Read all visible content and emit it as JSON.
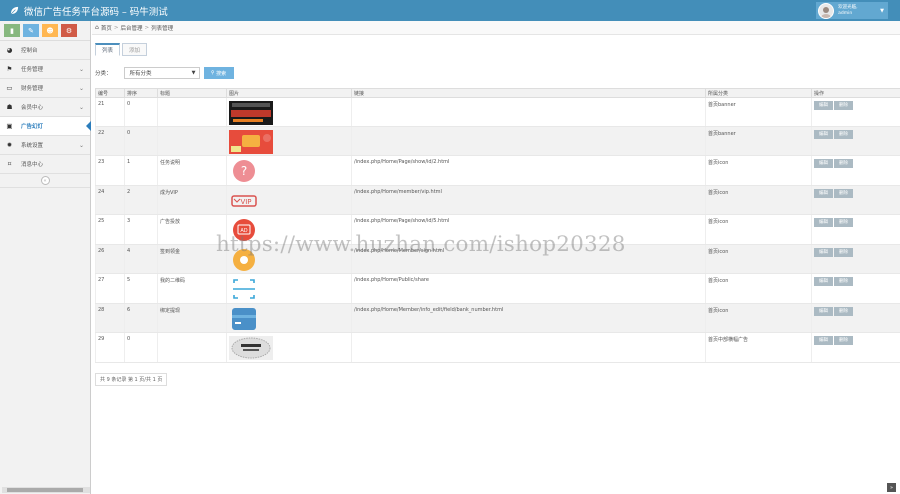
{
  "header": {
    "title": "微信广告任务平台源码 – 码牛测试",
    "user_line1": "欢迎光临,",
    "user_line2": "admin"
  },
  "sidebar": {
    "shortcuts": [
      {
        "icon": "signal-icon",
        "color": "#87b87f"
      },
      {
        "icon": "pencil-icon",
        "color": "#6fb3e0"
      },
      {
        "icon": "users-icon",
        "color": "#ffb752"
      },
      {
        "icon": "cogs-icon",
        "color": "#d15b47"
      }
    ],
    "items": [
      {
        "label": "控制台",
        "icon": "dashboard-icon",
        "has_chevron": false
      },
      {
        "label": "任务管理",
        "icon": "flag-icon",
        "has_chevron": true
      },
      {
        "label": "财务管理",
        "icon": "wallet-icon",
        "has_chevron": true
      },
      {
        "label": "会员中心",
        "icon": "user-icon",
        "has_chevron": true
      },
      {
        "label": "广告幻灯",
        "icon": "picture-icon",
        "has_chevron": false,
        "active": true
      },
      {
        "label": "系统设置",
        "icon": "gear-icon",
        "has_chevron": true
      },
      {
        "label": "消息中心",
        "icon": "bookmark-icon",
        "has_chevron": false
      }
    ]
  },
  "breadcrumb": {
    "home": "首页",
    "level2": "后台管理",
    "level3": "列表管理"
  },
  "tabs": [
    {
      "label": "列表",
      "active": true
    },
    {
      "label": "添加",
      "active": false
    }
  ],
  "filter": {
    "label": "分类：",
    "selected": "所有分类",
    "search_label": "搜索"
  },
  "table": {
    "columns": [
      "编号",
      "排序",
      "标题",
      "图片",
      "链接",
      "所属分类",
      "操作"
    ],
    "edit_label": "编辑",
    "delete_label": "删除",
    "rows": [
      {
        "id": "21",
        "sort": "0",
        "title": "",
        "link": "",
        "category": "首页banner",
        "pic": "banner-1"
      },
      {
        "id": "22",
        "sort": "0",
        "title": "",
        "link": "",
        "category": "首页banner",
        "pic": "banner-2"
      },
      {
        "id": "23",
        "sort": "1",
        "title": "任务说明",
        "link": "/index.php/Home/Page/show/id/2.html",
        "category": "首页icon",
        "pic": "question-icon"
      },
      {
        "id": "24",
        "sort": "2",
        "title": "成为VIP",
        "link": "/index.php/Home/member/vip.html",
        "category": "首页icon",
        "pic": "vip-icon"
      },
      {
        "id": "25",
        "sort": "3",
        "title": "广告投放",
        "link": "/index.php/Home/Page/show/id/5.html",
        "category": "首页icon",
        "pic": "ad-icon"
      },
      {
        "id": "26",
        "sort": "4",
        "title": "签到领金",
        "link": "/index.php/Home/Member/sign.html",
        "category": "首页icon",
        "pic": "coin-icon"
      },
      {
        "id": "27",
        "sort": "5",
        "title": "我的二维码",
        "link": "/index.php/Home/Public/share",
        "category": "首页icon",
        "pic": "qrcode-icon"
      },
      {
        "id": "28",
        "sort": "6",
        "title": "绑定提现",
        "link": "/index.php/Home/Member/info_edit/field/bank_number.html",
        "category": "首页icon",
        "pic": "card-icon"
      },
      {
        "id": "29",
        "sort": "0",
        "title": "",
        "link": "",
        "category": "首页中部横幅广告",
        "pic": "banner-3"
      }
    ]
  },
  "pager": {
    "text": "共 9 条记录 第 1 页/共 1 页"
  },
  "watermark": "https://www.huzhan.com/ishop20328"
}
